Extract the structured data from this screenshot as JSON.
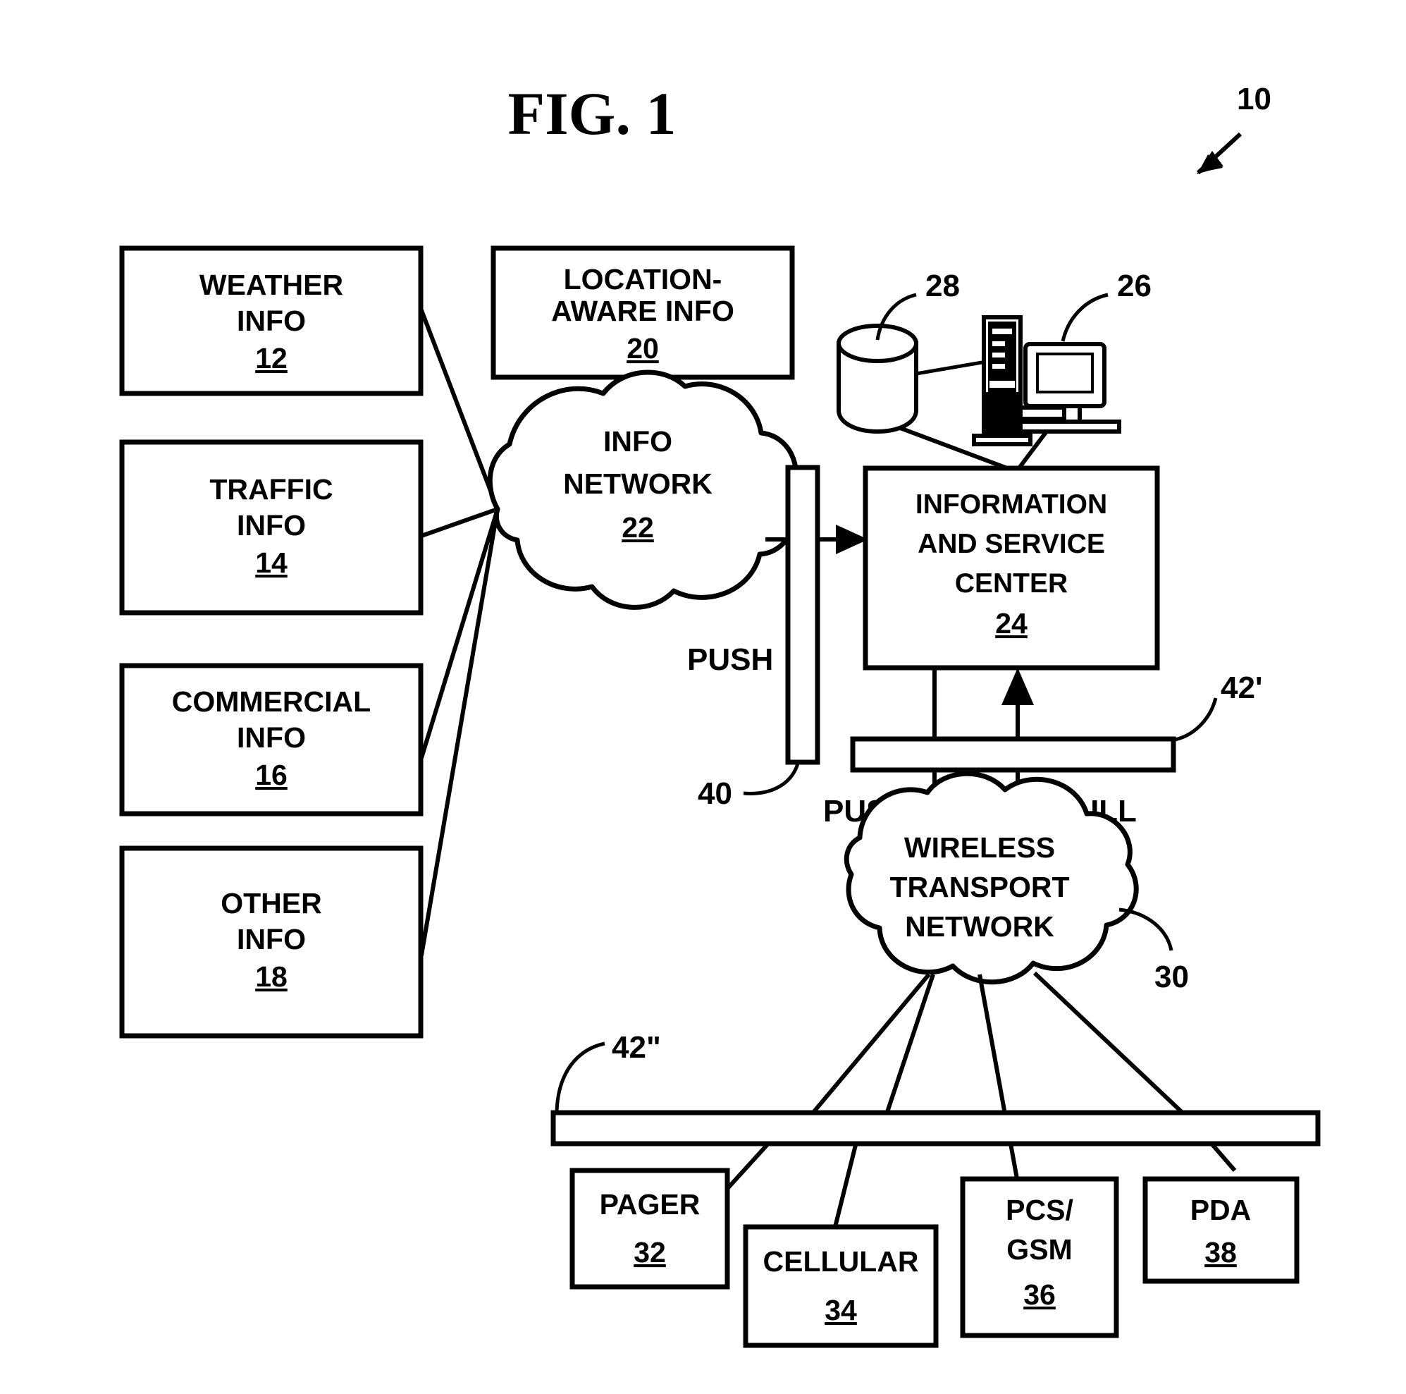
{
  "figure": {
    "title": "FIG. 1",
    "system_ref": "10"
  },
  "sources": [
    {
      "name": "weather-info",
      "lines": [
        "WEATHER",
        "INFO"
      ],
      "ref": "12"
    },
    {
      "name": "traffic-info",
      "lines": [
        "TRAFFIC",
        "INFO"
      ],
      "ref": "14"
    },
    {
      "name": "commercial-info",
      "lines": [
        "COMMERCIAL",
        "INFO"
      ],
      "ref": "16"
    },
    {
      "name": "other-info",
      "lines": [
        "OTHER",
        "INFO"
      ],
      "ref": "18"
    },
    {
      "name": "location-aware-info",
      "lines": [
        "LOCATION-",
        "AWARE INFO"
      ],
      "ref": "20"
    }
  ],
  "info_network": {
    "lines": [
      "INFO",
      "NETWORK"
    ],
    "ref": "22"
  },
  "service_center": {
    "lines": [
      "INFORMATION",
      "AND SERVICE",
      "CENTER"
    ],
    "ref": "24"
  },
  "peripherals": {
    "workstation_ref": "26",
    "database_ref": "28"
  },
  "interfaces": {
    "bar_40_ref": "40",
    "bar_42prime_ref": "42'",
    "bar_42doubleprime_ref": "42\""
  },
  "flows": {
    "push_to_center": "PUSH",
    "push_to_wireless": "PUSH",
    "pull_from_wireless": "PULL"
  },
  "wireless_network": {
    "lines": [
      "WIRELESS",
      "TRANSPORT",
      "NETWORK"
    ],
    "ref": "30"
  },
  "devices": [
    {
      "name": "pager",
      "lines": [
        "PAGER"
      ],
      "ref": "32"
    },
    {
      "name": "cellular",
      "lines": [
        "CELLULAR"
      ],
      "ref": "34"
    },
    {
      "name": "pcs-gsm",
      "lines": [
        "PCS/",
        "GSM"
      ],
      "ref": "36"
    },
    {
      "name": "pda",
      "lines": [
        "PDA"
      ],
      "ref": "38"
    }
  ],
  "colors": {
    "ink": "#000000",
    "paper": "#ffffff"
  }
}
